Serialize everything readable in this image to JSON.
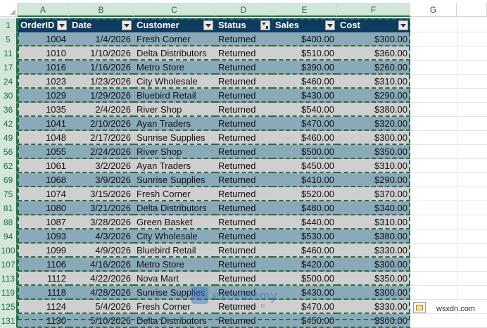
{
  "columns": [
    "A",
    "B",
    "C",
    "D",
    "E",
    "F",
    "G"
  ],
  "table": {
    "headers": [
      "OrderID",
      "Date",
      "Customer",
      "Status",
      "Sales",
      "Cost"
    ],
    "filtered_column": "Status",
    "rows": [
      {
        "row_num": "5",
        "values": [
          "1004",
          "1/4/2026",
          "Fresh Corner",
          "Returned",
          "$400.00",
          "$300.00"
        ]
      },
      {
        "row_num": "11",
        "values": [
          "1010",
          "1/10/2026",
          "Delta Distributors",
          "Returned",
          "$510.00",
          "$360.00"
        ]
      },
      {
        "row_num": "17",
        "values": [
          "1016",
          "1/16/2026",
          "Metro Store",
          "Returned",
          "$390.00",
          "$260.00"
        ]
      },
      {
        "row_num": "24",
        "values": [
          "1023",
          "1/23/2026",
          "City Wholesale",
          "Returned",
          "$460.00",
          "$310.00"
        ]
      },
      {
        "row_num": "30",
        "values": [
          "1029",
          "1/29/2026",
          "Bluebird Retail",
          "Returned",
          "$430.00",
          "$290.00"
        ]
      },
      {
        "row_num": "36",
        "values": [
          "1035",
          "2/4/2026",
          "River Shop",
          "Returned",
          "$540.00",
          "$380.00"
        ]
      },
      {
        "row_num": "42",
        "values": [
          "1041",
          "2/10/2026",
          "Ayan Traders",
          "Returned",
          "$470.00",
          "$320.00"
        ]
      },
      {
        "row_num": "49",
        "values": [
          "1048",
          "2/17/2026",
          "Sunrise Supplies",
          "Returned",
          "$460.00",
          "$300.00"
        ]
      },
      {
        "row_num": "56",
        "values": [
          "1055",
          "2/24/2026",
          "River Shop",
          "Returned",
          "$500.00",
          "$350.00"
        ]
      },
      {
        "row_num": "62",
        "values": [
          "1061",
          "3/2/2026",
          "Ayan Traders",
          "Returned",
          "$450.00",
          "$310.00"
        ]
      },
      {
        "row_num": "69",
        "values": [
          "1068",
          "3/9/2026",
          "Sunrise Supplies",
          "Returned",
          "$410.00",
          "$290.00"
        ]
      },
      {
        "row_num": "75",
        "values": [
          "1074",
          "3/15/2026",
          "Fresh Corner",
          "Returned",
          "$520.00",
          "$370.00"
        ]
      },
      {
        "row_num": "81",
        "values": [
          "1080",
          "3/21/2026",
          "Delta Distributors",
          "Returned",
          "$480.00",
          "$340.00"
        ]
      },
      {
        "row_num": "88",
        "values": [
          "1087",
          "3/28/2026",
          "Green Basket",
          "Returned",
          "$440.00",
          "$310.00"
        ]
      },
      {
        "row_num": "94",
        "values": [
          "1093",
          "4/3/2026",
          "City Wholesale",
          "Returned",
          "$530.00",
          "$380.00"
        ]
      },
      {
        "row_num": "100",
        "values": [
          "1099",
          "4/9/2026",
          "Bluebird Retail",
          "Returned",
          "$460.00",
          "$330.00"
        ]
      },
      {
        "row_num": "107",
        "values": [
          "1106",
          "4/16/2026",
          "Metro Store",
          "Returned",
          "$420.00",
          "$300.00"
        ]
      },
      {
        "row_num": "113",
        "values": [
          "1112",
          "4/22/2026",
          "Nova Mart",
          "Returned",
          "$500.00",
          "$350.00"
        ]
      },
      {
        "row_num": "119",
        "values": [
          "1118",
          "4/28/2026",
          "Sunrise Supplies",
          "Returned",
          "$430.00",
          "$300.00"
        ]
      },
      {
        "row_num": "125",
        "values": [
          "1124",
          "5/4/2026",
          "Fresh Corner",
          "Returned",
          "$470.00",
          "$330.00"
        ]
      },
      {
        "row_num": "131",
        "values": [
          "1130",
          "5/10/2026",
          "Delta Distributors",
          "Returned",
          "$450.00",
          "$300.00"
        ]
      }
    ]
  },
  "header_row_num": "1",
  "watermark": "wsxdn.com",
  "colors": {
    "header_bg": "#0f3b5f",
    "band_odd": "#8aa9b9",
    "band_even": "#cfcfcf",
    "selection": "#1e7145"
  }
}
